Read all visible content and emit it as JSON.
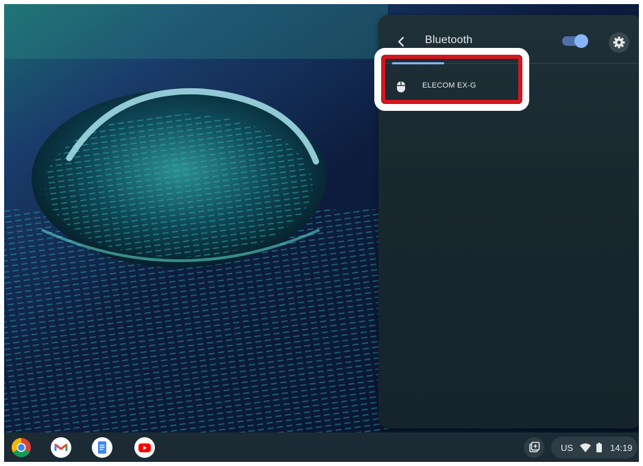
{
  "bluetooth_panel": {
    "back_icon": "chevron-left-icon",
    "title": "Bluetooth",
    "toggle_state": "on",
    "settings_icon": "gear-icon",
    "devices": [
      {
        "name": "ELECOM EX-G",
        "icon": "mouse-icon"
      }
    ]
  },
  "highlight_color": "#d6151d",
  "shelf": {
    "apps": [
      {
        "name": "Chrome",
        "icon": "chrome-icon"
      },
      {
        "name": "Gmail",
        "icon": "gmail-icon"
      },
      {
        "name": "Docs",
        "icon": "docs-icon"
      },
      {
        "name": "YouTube",
        "icon": "youtube-icon"
      }
    ],
    "tray": {
      "ime": "US",
      "time": "14:19"
    }
  },
  "colors": {
    "accent": "#8ab4f8",
    "panel_bg": "#1f3038",
    "shelf_bg": "#1c2a33"
  }
}
